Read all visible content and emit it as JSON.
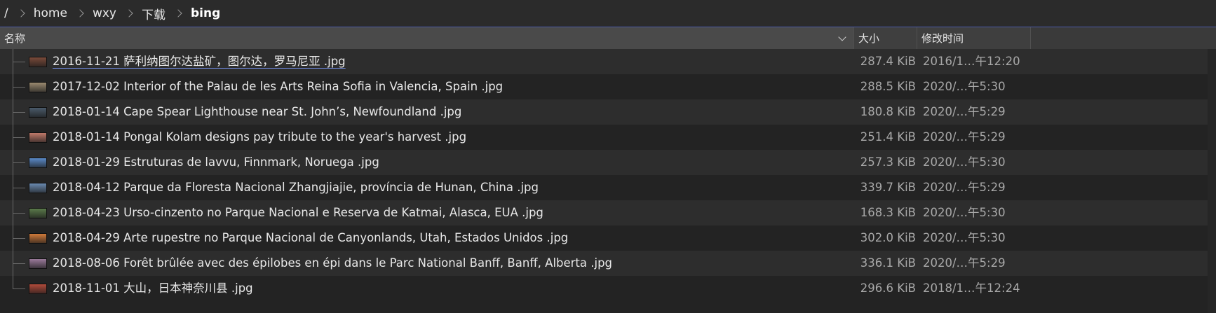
{
  "breadcrumb": {
    "root": "/",
    "items": [
      "home",
      "wxy",
      "下载"
    ],
    "current": "bing"
  },
  "columns": {
    "name": "名称",
    "size": "大小",
    "modified": "修改时间"
  },
  "files": [
    {
      "name": "2016-11-21 萨利纳图尔达盐矿，图尔达，罗马尼亚 .jpg",
      "size": "287.4 KiB",
      "modified": "2016/1…午12:20",
      "thumb_color": "#7a4a3a"
    },
    {
      "name": "2017-12-02 Interior of the Palau de les Arts Reina Sofia in Valencia, Spain .jpg",
      "size": "288.5 KiB",
      "modified": "2020/…午5:30",
      "thumb_color": "#9a8a70"
    },
    {
      "name": "2018-01-14 Cape Spear Lighthouse near St. John’s, Newfoundland .jpg",
      "size": "180.8 KiB",
      "modified": "2020/…午5:29",
      "thumb_color": "#4a5a6a"
    },
    {
      "name": "2018-01-14 Pongal Kolam designs pay tribute to the year's harvest .jpg",
      "size": "251.4 KiB",
      "modified": "2020/…午5:29",
      "thumb_color": "#c07a6a"
    },
    {
      "name": "2018-01-29 Estruturas de lavvu, Finnmark, Noruega .jpg",
      "size": "257.3 KiB",
      "modified": "2020/…午5:30",
      "thumb_color": "#5a8ac8"
    },
    {
      "name": "2018-04-12 Parque da Floresta Nacional Zhangjiajie, província de Hunan, China .jpg",
      "size": "339.7 KiB",
      "modified": "2020/…午5:29",
      "thumb_color": "#6a8ab0"
    },
    {
      "name": "2018-04-23 Urso-cinzento no Parque Nacional e Reserva de Katmai, Alasca, EUA .jpg",
      "size": "168.3 KiB",
      "modified": "2020/…午5:30",
      "thumb_color": "#5a7a4a"
    },
    {
      "name": "2018-04-29 Arte rupestre no Parque Nacional de Canyonlands, Utah, Estados Unidos .jpg",
      "size": "302.0 KiB",
      "modified": "2020/…午5:30",
      "thumb_color": "#d07a3a"
    },
    {
      "name": "2018-08-06 Forêt brûlée avec des épilobes en épi dans le Parc National Banff, Banff, Alberta .jpg",
      "size": "336.1 KiB",
      "modified": "2020/…午5:29",
      "thumb_color": "#9a7a9a"
    },
    {
      "name": "2018-11-01 大山，日本神奈川县 .jpg",
      "size": "296.6 KiB",
      "modified": "2018/1…午12:24",
      "thumb_color": "#b04a3a"
    }
  ],
  "colors": {
    "header_accent": "#4a5aa8",
    "selection_underline": "#6d86d8"
  },
  "selected_index": 0
}
